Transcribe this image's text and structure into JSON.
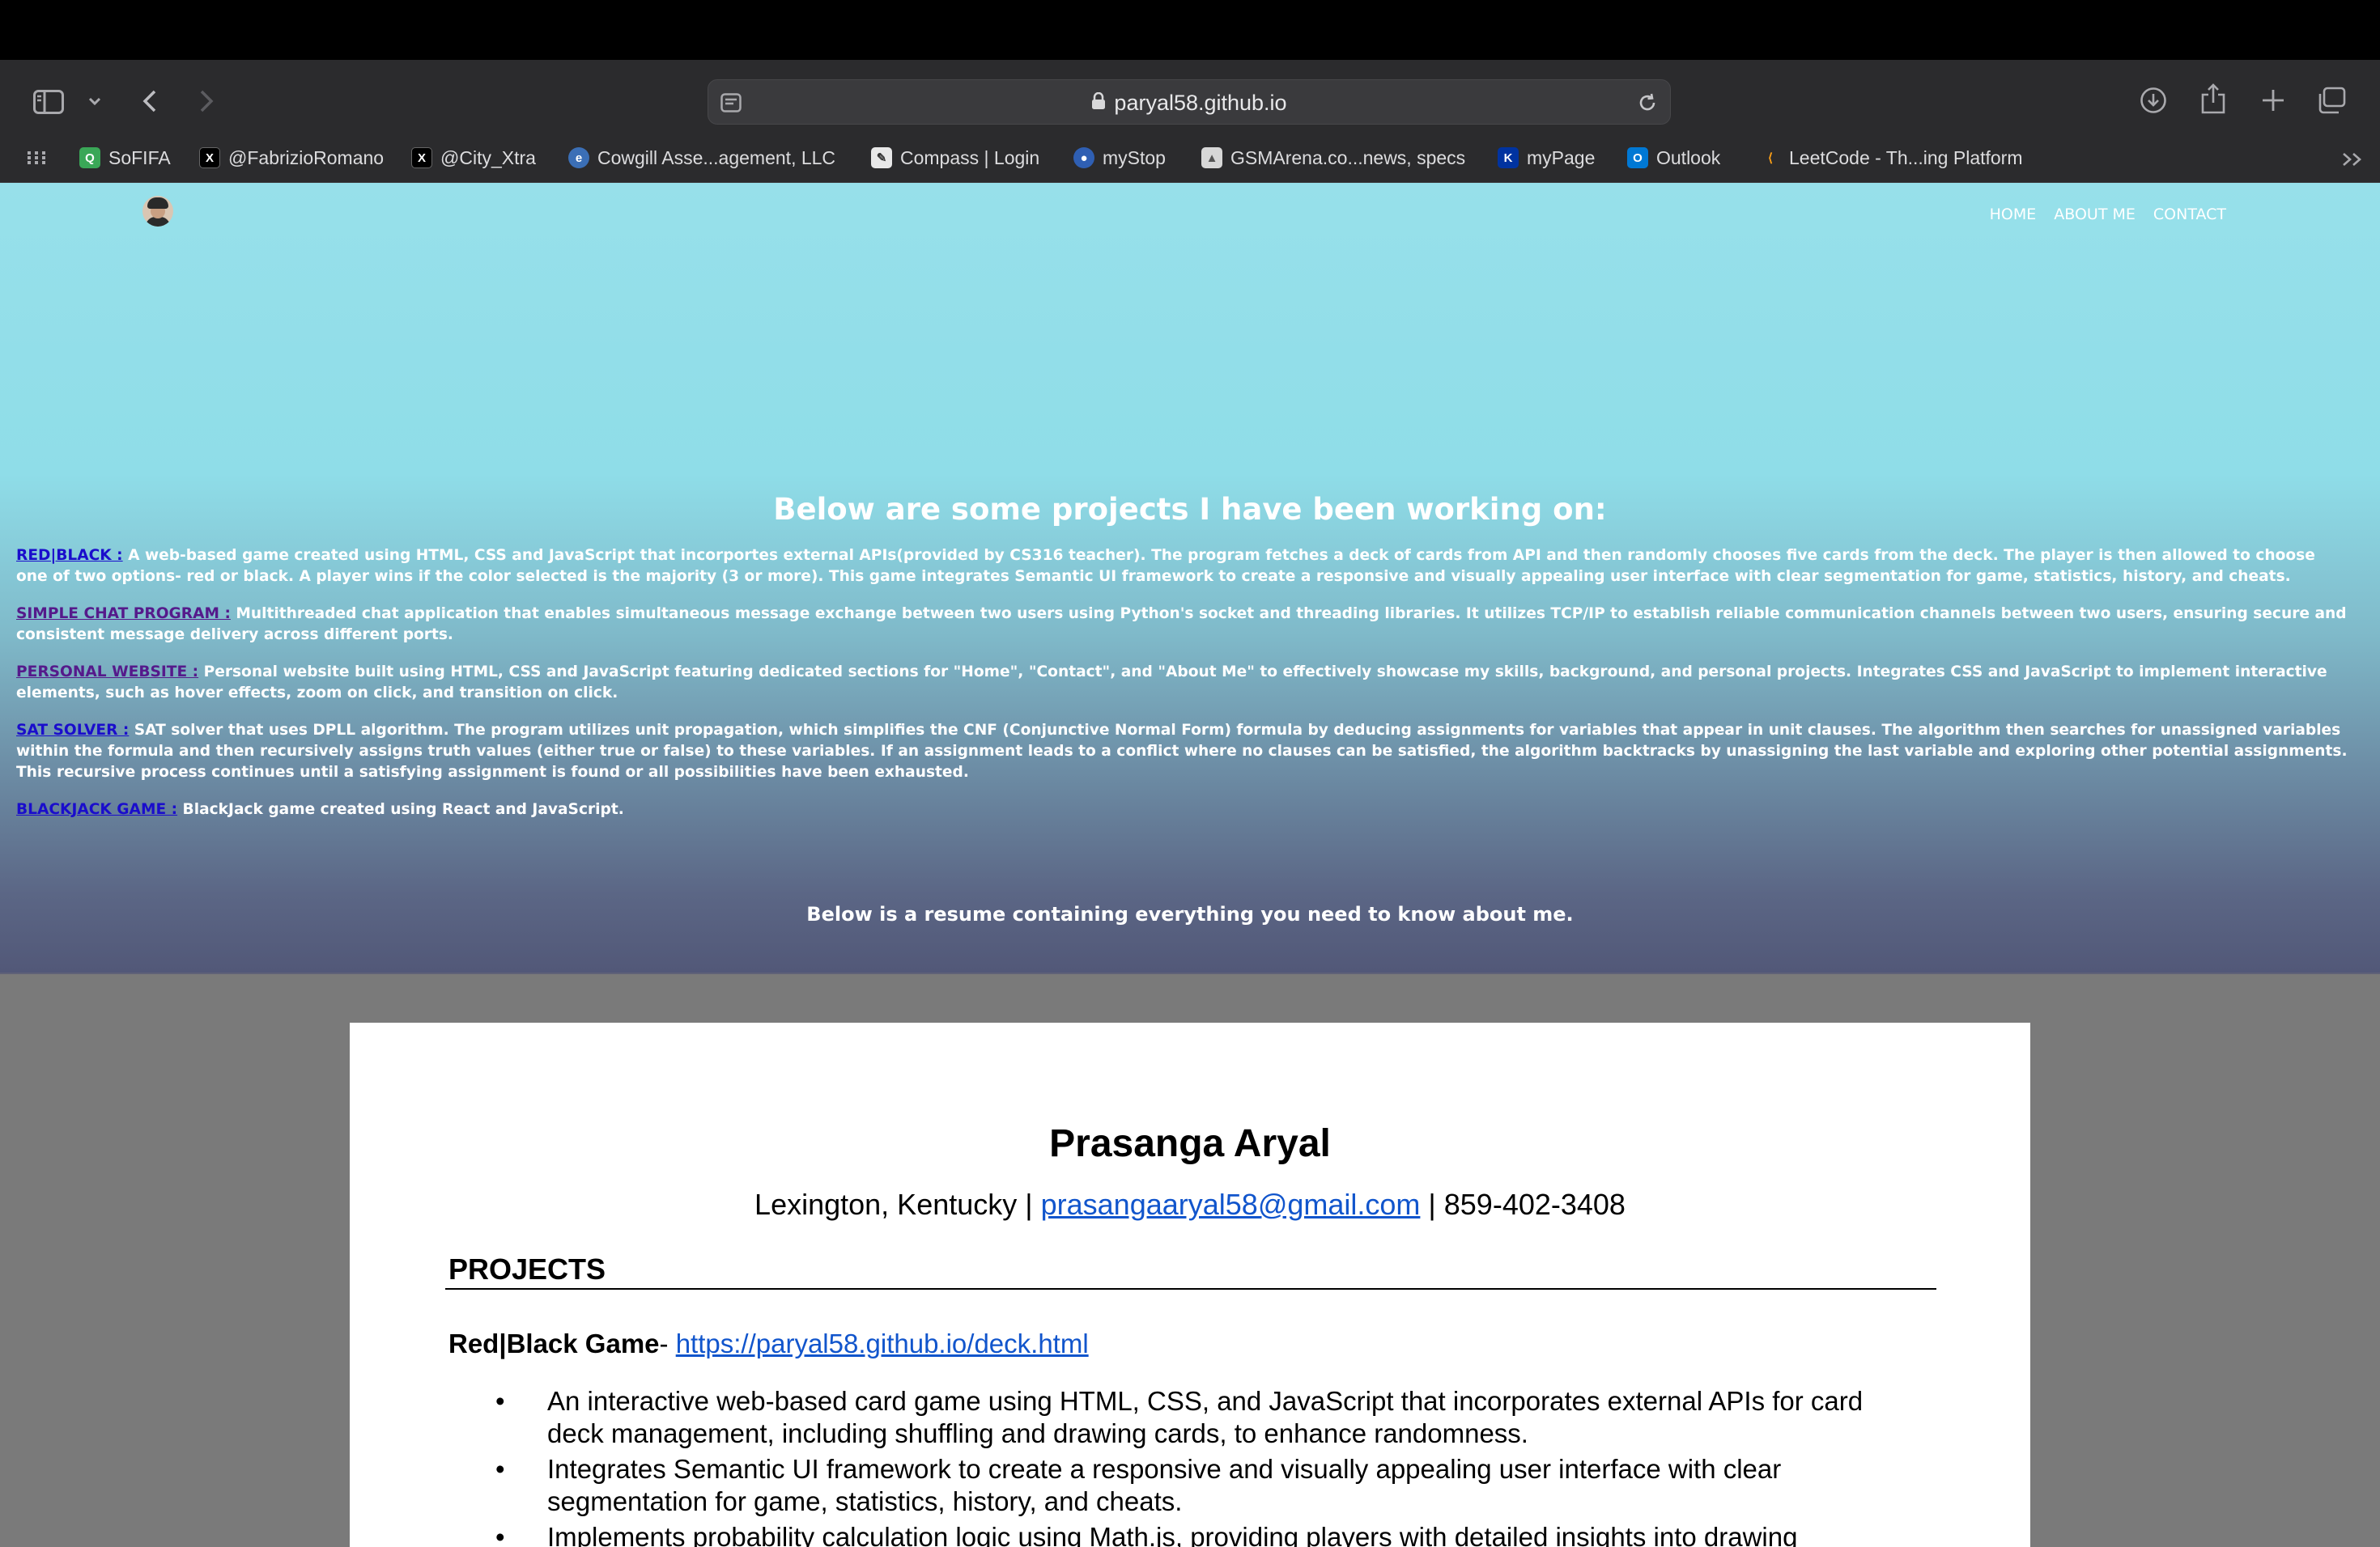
{
  "browser": {
    "url": "paryal58.github.io",
    "bookmarks": [
      {
        "label": "SoFIFA",
        "icon": "sofifa-icon",
        "color": "#3aa757"
      },
      {
        "label": "@FabrizioRomano",
        "icon": "x-icon",
        "color": "#000000"
      },
      {
        "label": "@City_Xtra",
        "icon": "x-icon",
        "color": "#000000"
      },
      {
        "label": "Cowgill Asse...agement, LLC",
        "icon": "cowgill-icon",
        "color": "#3b6fb6"
      },
      {
        "label": "Compass | Login",
        "icon": "compass-icon",
        "color": "#e8e8e8"
      },
      {
        "label": "myStop",
        "icon": "mystop-icon",
        "color": "#2f5fb3"
      },
      {
        "label": "GSMArena.co...news, specs",
        "icon": "gsmarena-icon",
        "color": "#d7d7d7"
      },
      {
        "label": "myPage",
        "icon": "uk-icon",
        "color": "#0033a0"
      },
      {
        "label": "Outlook",
        "icon": "outlook-icon",
        "color": "#0078d4"
      },
      {
        "label": "LeetCode - Th...ing Platform",
        "icon": "leetcode-icon",
        "color": "#ffa116"
      }
    ]
  },
  "nav": {
    "home": "HOME",
    "about": "ABOUT ME",
    "contact": "CONTACT"
  },
  "projects": {
    "title": "Below are some projects I have been working on:",
    "items": [
      {
        "link": "RED|BLACK :",
        "text": " A web-based game created using HTML, CSS and JavaScript that incorportes external APIs(provided by CS316 teacher). The program fetches a deck of cards from API and then randomly chooses five cards from the deck. The player is then allowed to choose one of two options- red or black. A player wins if the color selected is the majority (3 or more). This game integrates Semantic UI framework to create a responsive and visually appealing user interface with clear segmentation for game, statistics, history, and cheats."
      },
      {
        "link": "SIMPLE CHAT PROGRAM :",
        "text": " Multithreaded chat application that enables simultaneous message exchange between two users using Python's socket and threading libraries. It utilizes TCP/IP to establish reliable communication channels between two users, ensuring secure and consistent message delivery across different ports."
      },
      {
        "link": "PERSONAL WEBSITE :",
        "text": " Personal website built using HTML, CSS and JavaScript featuring dedicated sections for \"Home\", \"Contact\", and \"About Me\" to effectively showcase my skills, background, and personal projects. Integrates CSS and JavaScript to implement interactive elements, such as hover effects, zoom on click, and transition on click."
      },
      {
        "link": "SAT SOLVER :",
        "text": " SAT solver that uses DPLL algorithm. The program utilizes unit propagation, which simplifies the CNF (Conjunctive Normal Form) formula by deducing assignments for variables that appear in unit clauses. The algorithm then searches for unassigned variables within the formula and then recursively assigns truth values (either true or false) to these variables. If an assignment leads to a conflict where no clauses can be satisfied, the algorithm backtracks by unassigning the last variable and exploring other potential assignments. This recursive process continues until a satisfying assignment is found or all possibilities have been exhausted."
      },
      {
        "link": "BLACKJACK GAME :",
        "text": " BlackJack game created using React and JavaScript."
      }
    ],
    "resume_intro": "Below is a resume containing everything you need to know about me."
  },
  "resume": {
    "name": "Prasanga Aryal",
    "location": "Lexington, Kentucky | ",
    "email": "prasangaaryal58@gmail.com",
    "phone": " | 859-402-3408",
    "section": "PROJECTS",
    "project_title": "Red|Black Game",
    "project_dash": "- ",
    "project_link": "https://paryal58.github.io/deck.html",
    "bullets": [
      "An interactive web-based card game using HTML, CSS, and JavaScript that incorporates external APIs for card deck management, including shuffling and drawing cards, to enhance randomness.",
      "Integrates Semantic UI framework to create a responsive and visually appealing user interface with clear segmentation for game, statistics, history, and cheats.",
      "Implements probability calculation logic using Math.js, providing players with detailed insights into drawing probabilities and overall outcomes."
    ]
  }
}
